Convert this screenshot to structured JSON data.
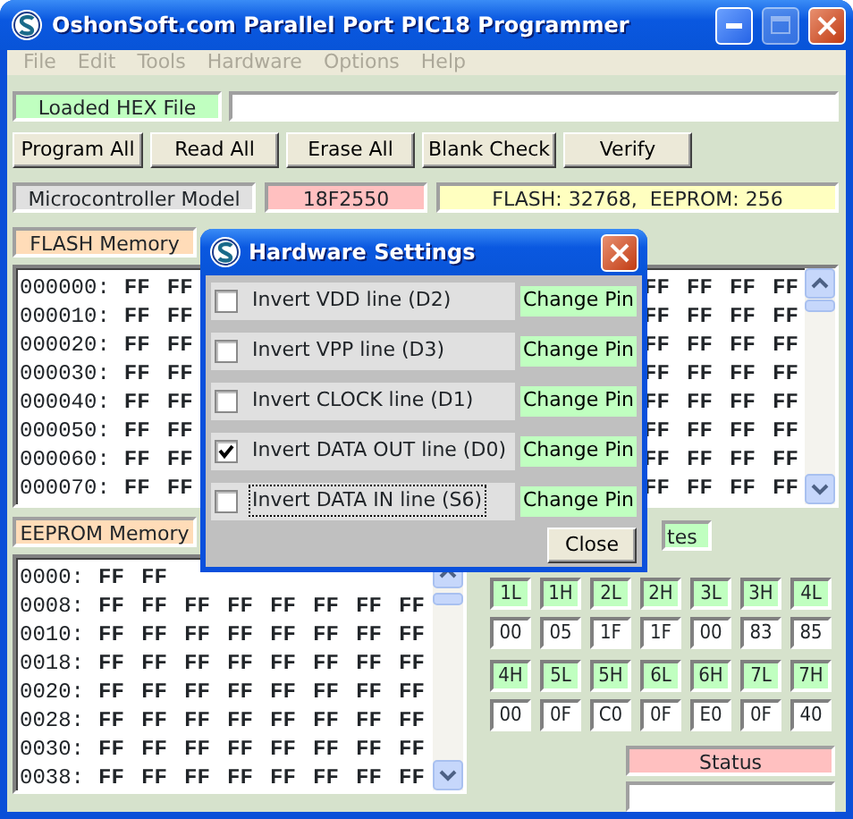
{
  "window": {
    "title": "OshonSoft.com Parallel Port PIC18 Programmer",
    "maximize_enabled": false
  },
  "menu": [
    {
      "label": "File",
      "disabled": true
    },
    {
      "label": "Edit",
      "disabled": true
    },
    {
      "label": "Tools",
      "disabled": true
    },
    {
      "label": "Hardware",
      "disabled": true
    },
    {
      "label": "Options",
      "disabled": true
    },
    {
      "label": "Help",
      "disabled": true
    }
  ],
  "hex_file": {
    "label": "Loaded HEX File"
  },
  "buttons": [
    "Program All",
    "Read All",
    "Erase All",
    "Blank Check",
    "Verify"
  ],
  "model": {
    "label": "Microcontroller Model",
    "value": "18F2550",
    "memory": "FLASH: 32768,  EEPROM: 256"
  },
  "flash": {
    "label": "FLASH Memory",
    "rows": [
      {
        "address": "000000:",
        "left": [
          "FF",
          "FF"
        ],
        "right": [
          "FF",
          "FF",
          "FF",
          "FF"
        ]
      },
      {
        "address": "000010:",
        "left": [
          "FF",
          "FF"
        ],
        "right": [
          "FF",
          "FF",
          "FF",
          "FF"
        ]
      },
      {
        "address": "000020:",
        "left": [
          "FF",
          "FF"
        ],
        "right": [
          "FF",
          "FF",
          "FF",
          "FF"
        ]
      },
      {
        "address": "000030:",
        "left": [
          "FF",
          "FF"
        ],
        "right": [
          "FF",
          "FF",
          "FF",
          "FF"
        ]
      },
      {
        "address": "000040:",
        "left": [
          "FF",
          "FF"
        ],
        "right": [
          "FF",
          "FF",
          "FF",
          "FF"
        ]
      },
      {
        "address": "000050:",
        "left": [
          "FF",
          "FF"
        ],
        "right": [
          "FF",
          "FF",
          "FF",
          "FF"
        ]
      },
      {
        "address": "000060:",
        "left": [
          "FF",
          "FF"
        ],
        "right": [
          "FF",
          "FF",
          "FF",
          "FF"
        ]
      },
      {
        "address": "000070:",
        "left": [
          "FF",
          "FF"
        ],
        "right": [
          "FF",
          "FF",
          "FF",
          "FF"
        ]
      }
    ]
  },
  "eeprom": {
    "label": "EEPROM Memory",
    "rows": [
      {
        "address": "0000:",
        "bytes": [
          "FF",
          "FF"
        ]
      },
      {
        "address": "0008:",
        "bytes": [
          "FF",
          "FF",
          "FF",
          "FF",
          "FF",
          "FF",
          "FF",
          "FF"
        ]
      },
      {
        "address": "0010:",
        "bytes": [
          "FF",
          "FF",
          "FF",
          "FF",
          "FF",
          "FF",
          "FF",
          "FF"
        ]
      },
      {
        "address": "0018:",
        "bytes": [
          "FF",
          "FF",
          "FF",
          "FF",
          "FF",
          "FF",
          "FF",
          "FF"
        ]
      },
      {
        "address": "0020:",
        "bytes": [
          "FF",
          "FF",
          "FF",
          "FF",
          "FF",
          "FF",
          "FF",
          "FF"
        ]
      },
      {
        "address": "0028:",
        "bytes": [
          "FF",
          "FF",
          "FF",
          "FF",
          "FF",
          "FF",
          "FF",
          "FF"
        ]
      },
      {
        "address": "0030:",
        "bytes": [
          "FF",
          "FF",
          "FF",
          "FF",
          "FF",
          "FF",
          "FF",
          "FF"
        ]
      },
      {
        "address": "0038:",
        "bytes": [
          "FF",
          "FF",
          "FF",
          "FF",
          "FF",
          "FF",
          "FF",
          "FF"
        ]
      }
    ]
  },
  "config": {
    "label": "tes",
    "rows": [
      {
        "kind": "header",
        "cells": [
          "1L",
          "1H",
          "2L",
          "2H",
          "3L",
          "3H",
          "4L"
        ]
      },
      {
        "kind": "value",
        "cells": [
          "00",
          "05",
          "1F",
          "1F",
          "00",
          "83",
          "85"
        ]
      },
      {
        "kind": "header",
        "cells": [
          "4H",
          "5L",
          "5H",
          "6L",
          "6H",
          "7L",
          "7H"
        ]
      },
      {
        "kind": "value",
        "cells": [
          "00",
          "0F",
          "C0",
          "0F",
          "E0",
          "0F",
          "40"
        ]
      }
    ]
  },
  "status": {
    "label": "Status"
  },
  "dialog": {
    "title": "Hardware Settings",
    "options": [
      {
        "label": "Invert VDD line (D2)",
        "checked": false,
        "focused": false,
        "button": "Change Pin"
      },
      {
        "label": "Invert VPP line (D3)",
        "checked": false,
        "focused": false,
        "button": "Change Pin"
      },
      {
        "label": "Invert CLOCK line (D1)",
        "checked": false,
        "focused": false,
        "button": "Change Pin"
      },
      {
        "label": "Invert DATA OUT line (D0)",
        "checked": true,
        "focused": false,
        "button": "Change Pin"
      },
      {
        "label": "Invert DATA IN line (S6)",
        "checked": false,
        "focused": true,
        "button": "Change Pin"
      }
    ],
    "close": "Close"
  }
}
